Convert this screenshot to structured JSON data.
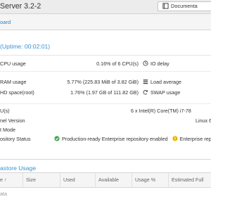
{
  "header": {
    "product_title": "Server 3.2-2",
    "docs_button_label": "Documenta"
  },
  "breadcrumb": {
    "text": "oard"
  },
  "status_panel": {
    "title": "(Uptime: 00:02:01)",
    "rows": [
      {
        "label": "CPU usage",
        "value": "0.16% of 6 CPU(s)",
        "right_label": "IO delay",
        "right_icon": "clock-icon"
      },
      {
        "label": "RAM usage",
        "value": "5.77% (225.83 MiB of 3.82 GiB)",
        "right_label": "Load average",
        "right_icon": "tasks-icon"
      },
      {
        "label": "HD space(root)",
        "value": "1.76% (1.97 GB of 111.82 GB)",
        "right_label": "SWAP usage",
        "right_icon": "refresh-icon"
      }
    ],
    "info_rows": [
      {
        "label": "U(s)",
        "value": "6 x Intel(R) Core(TM) i7-78"
      },
      {
        "label": "nel Version",
        "value": "Linux 6"
      },
      {
        "label": "t Mode",
        "value": ""
      }
    ],
    "repository": {
      "label": "ository Status",
      "ok_text": "Production-ready Enterprise repository enabled",
      "warn_text": "Enterprise repo"
    }
  },
  "datastore_panel": {
    "title": "astore Usage",
    "columns": [
      "e ↑",
      "Size",
      "Used",
      "Available",
      "Usage %",
      "Estimated Full"
    ],
    "empty_text": "ata"
  },
  "colors": {
    "accent": "#3892d4",
    "ok": "#3fa34d",
    "warning": "#e8b400"
  }
}
